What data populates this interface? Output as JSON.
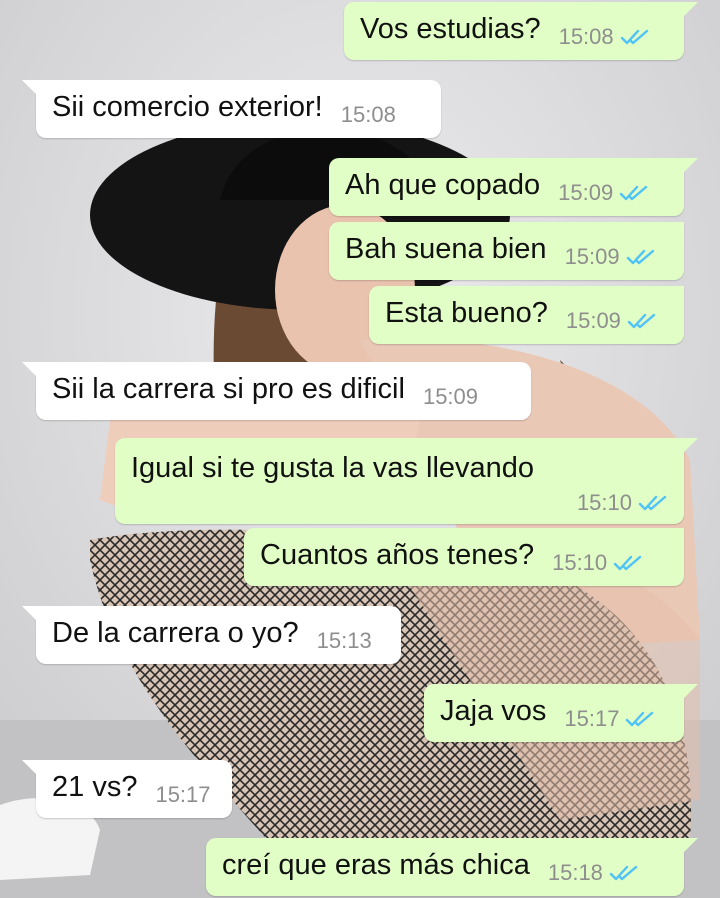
{
  "colors": {
    "incoming_bubble": "#ffffff",
    "outgoing_bubble": "#e1fec6",
    "read_ticks": "#4fc3f7",
    "timestamp": "#8e8e8e"
  },
  "messages": [
    {
      "dir": "out",
      "text": "Vos estudias?",
      "time": "15:08",
      "status": "read"
    },
    {
      "dir": "in",
      "text": "Sii comercio exterior!",
      "time": "15:08"
    },
    {
      "dir": "out",
      "text": "Ah que copado",
      "time": "15:09",
      "status": "read"
    },
    {
      "dir": "out",
      "text": "Bah suena bien",
      "time": "15:09",
      "status": "read"
    },
    {
      "dir": "out",
      "text": "Esta bueno?",
      "time": "15:09",
      "status": "read"
    },
    {
      "dir": "in",
      "text": "Sii la carrera si pro es dificil",
      "time": "15:09"
    },
    {
      "dir": "out",
      "text": "Igual si te gusta la vas llevando",
      "time": "15:10",
      "status": "read"
    },
    {
      "dir": "out",
      "text": "Cuantos años tenes?",
      "time": "15:10",
      "status": "read"
    },
    {
      "dir": "in",
      "text": "De la carrera o yo?",
      "time": "15:13"
    },
    {
      "dir": "out",
      "text": "Jaja vos",
      "time": "15:17",
      "status": "read"
    },
    {
      "dir": "in",
      "text": "21 vs?",
      "time": "15:17"
    },
    {
      "dir": "out",
      "text": "creí que eras más chica",
      "time": "15:18",
      "status": "read"
    }
  ]
}
